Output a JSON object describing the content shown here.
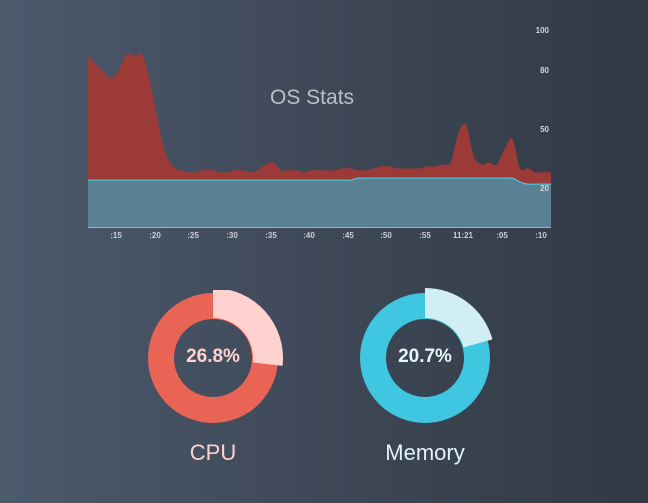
{
  "title": "OS Stats",
  "colors": {
    "cpu": "#ea6455",
    "cpu_light": "#ffd2cf",
    "memory": "#3fc6e0",
    "memory_light": "#d2eef5",
    "cpu_area": "#9b3a36",
    "mem_area": "#5b7f93",
    "mem_line": "#4fd2e8"
  },
  "chart_data": {
    "type": "area",
    "x_ticks": [
      ":15",
      ":20",
      ":25",
      ":30",
      ":35",
      ":40",
      ":45",
      ":50",
      ":55",
      "11:21",
      ":05",
      ":10"
    ],
    "y_ticks": [
      100,
      80,
      50,
      20
    ],
    "ylim": [
      0,
      100
    ],
    "series": [
      {
        "values": [
          87,
          83,
          79,
          76,
          80,
          88,
          87,
          88,
          75,
          55,
          38,
          31,
          29,
          28,
          28,
          29,
          29,
          28,
          28,
          29,
          29,
          28,
          29,
          32,
          33,
          29,
          29,
          29,
          28,
          29,
          29,
          29,
          29,
          30,
          30,
          29,
          29,
          30,
          31,
          31,
          30,
          30,
          30,
          30,
          31,
          31,
          32,
          33,
          48,
          52,
          36,
          32,
          33,
          32,
          40,
          45,
          30,
          30,
          28,
          28,
          28
        ]
      },
      {
        "values": [
          24,
          24,
          24,
          24,
          24,
          24,
          24,
          24,
          24,
          24,
          24,
          24,
          24,
          24,
          24,
          24,
          24,
          24,
          24,
          24,
          24,
          24,
          24,
          24,
          24,
          24,
          24,
          24,
          24,
          24,
          24,
          24,
          24,
          24,
          24,
          25,
          25,
          25,
          25,
          25,
          25,
          25,
          25,
          25,
          25,
          25,
          25,
          25,
          25,
          25,
          25,
          25,
          25,
          25,
          25,
          25,
          23,
          22,
          22,
          22,
          22
        ]
      }
    ]
  },
  "cpu": {
    "percent": 26.8,
    "label_value": "26.8%",
    "label": "CPU"
  },
  "memory": {
    "percent": 20.7,
    "label_value": "20.7%",
    "label": "Memory"
  }
}
